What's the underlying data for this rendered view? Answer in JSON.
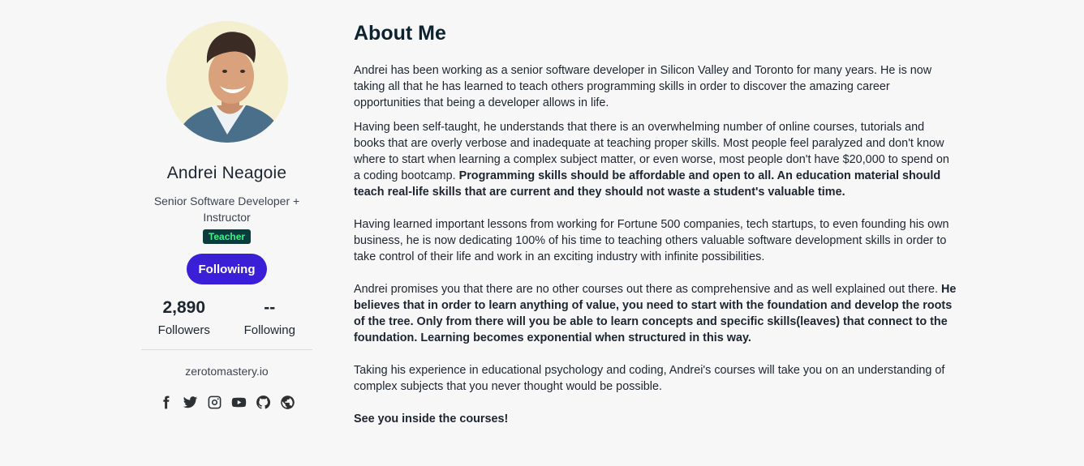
{
  "profile": {
    "name": "Andrei Neagoie",
    "headline": "Senior Software Developer + Instructor",
    "badge": "Teacher",
    "follow_button": "Following",
    "followers_value": "2,890",
    "followers_label": "Followers",
    "following_value": "--",
    "following_label": "Following",
    "website": "zerotomastery.io",
    "socials": [
      "facebook-icon",
      "twitter-icon",
      "instagram-icon",
      "youtube-icon",
      "github-icon",
      "globe-icon"
    ]
  },
  "about": {
    "title": "About Me",
    "p1": "Andrei has been working as a senior software developer in Silicon Valley and Toronto for many years. He is now taking all that he has learned to teach others programming skills in order to discover the amazing career opportunities that being a developer allows in life.",
    "p2_regular": "Having been self-taught, he understands that there is an overwhelming number of online courses, tutorials and books that are overly verbose and inadequate at teaching proper skills. Most people feel paralyzed and don't know where to start when learning a complex subject matter, or even worse, most people don't have $20,000 to spend on a coding bootcamp. ",
    "p2_bold": "Programming skills should be affordable and open to all. An education material should teach real-life skills that are current and they should not waste a student's valuable time.",
    "p3": "Having learned important lessons from working for Fortune 500 companies, tech startups, to even founding his own business, he is now dedicating 100% of his time to teaching others valuable software development skills in order to take control of their life and work in an exciting industry with infinite possibilities.",
    "p4_regular": "Andrei promises you that there are no other courses out there as comprehensive and as well explained out there. ",
    "p4_bold": "He believes that in order to learn anything of value, you need to start with the foundation and develop the roots of the tree. Only from there will you be able to learn concepts and specific skills(leaves) that connect to the foundation. Learning becomes exponential when structured in this way.",
    "p5": "Taking his experience in educational psychology and coding, Andrei's courses will take you on an understanding of complex subjects that you never thought would be possible.",
    "p6": "See you inside the courses!"
  },
  "colors": {
    "accent": "#3a1fd6",
    "badge_bg": "#0b3c3c",
    "badge_text": "#3ff08a",
    "avatar_bg": "#f4efcf"
  }
}
